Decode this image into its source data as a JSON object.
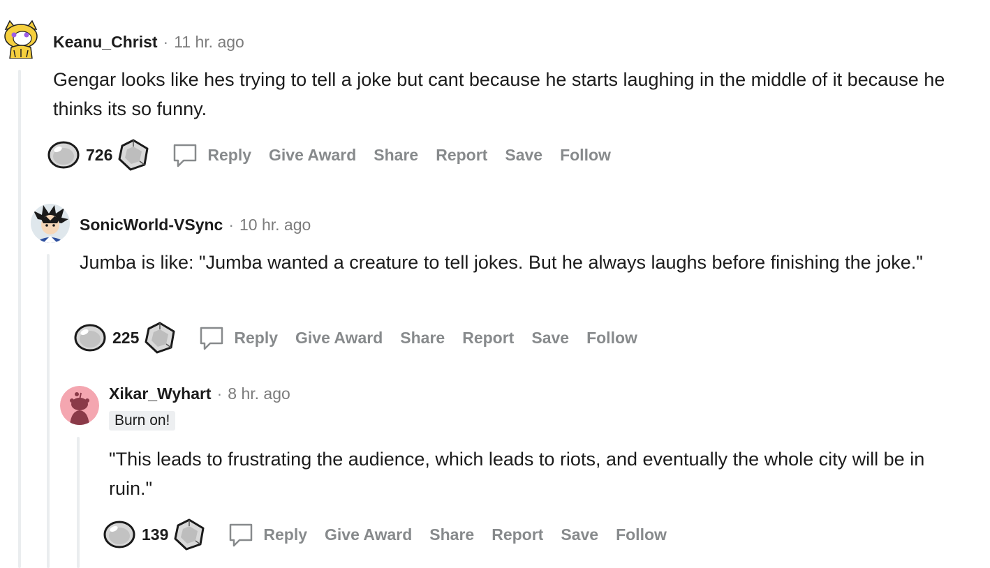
{
  "comments": [
    {
      "username": "Keanu_Christ",
      "time": "11 hr. ago",
      "body": "Gengar looks like hes trying to tell a joke but cant because he starts laughing in the middle of it because he thinks its so funny.",
      "score": "726",
      "avatar_icon": "snoo-cat-avatar-icon"
    },
    {
      "username": "SonicWorld-VSync",
      "time": "10 hr. ago",
      "body": "Jumba is like: \"Jumba wanted a creature to tell jokes. But he always laughs before finishing the joke.\"",
      "score": "225",
      "avatar_icon": "anime-character-avatar-icon"
    },
    {
      "username": "Xikar_Wyhart",
      "time": "8 hr. ago",
      "flair": "Burn on!",
      "body": "\"This leads to frustrating the audience, which leads to riots, and eventually the whole city will be in ruin.\"",
      "score": "139",
      "avatar_icon": "default-snoo-avatar-icon"
    }
  ],
  "actions": {
    "reply": "Reply",
    "give_award": "Give Award",
    "share": "Share",
    "report": "Report",
    "save": "Save",
    "follow": "Follow"
  },
  "separator": "·",
  "colors": {
    "meta_gray": "#878a8c",
    "thread_line": "#eaedef",
    "text": "#1c1c1c",
    "flair_bg": "#edeff1",
    "avatar_pink": "#f4a6b0"
  }
}
